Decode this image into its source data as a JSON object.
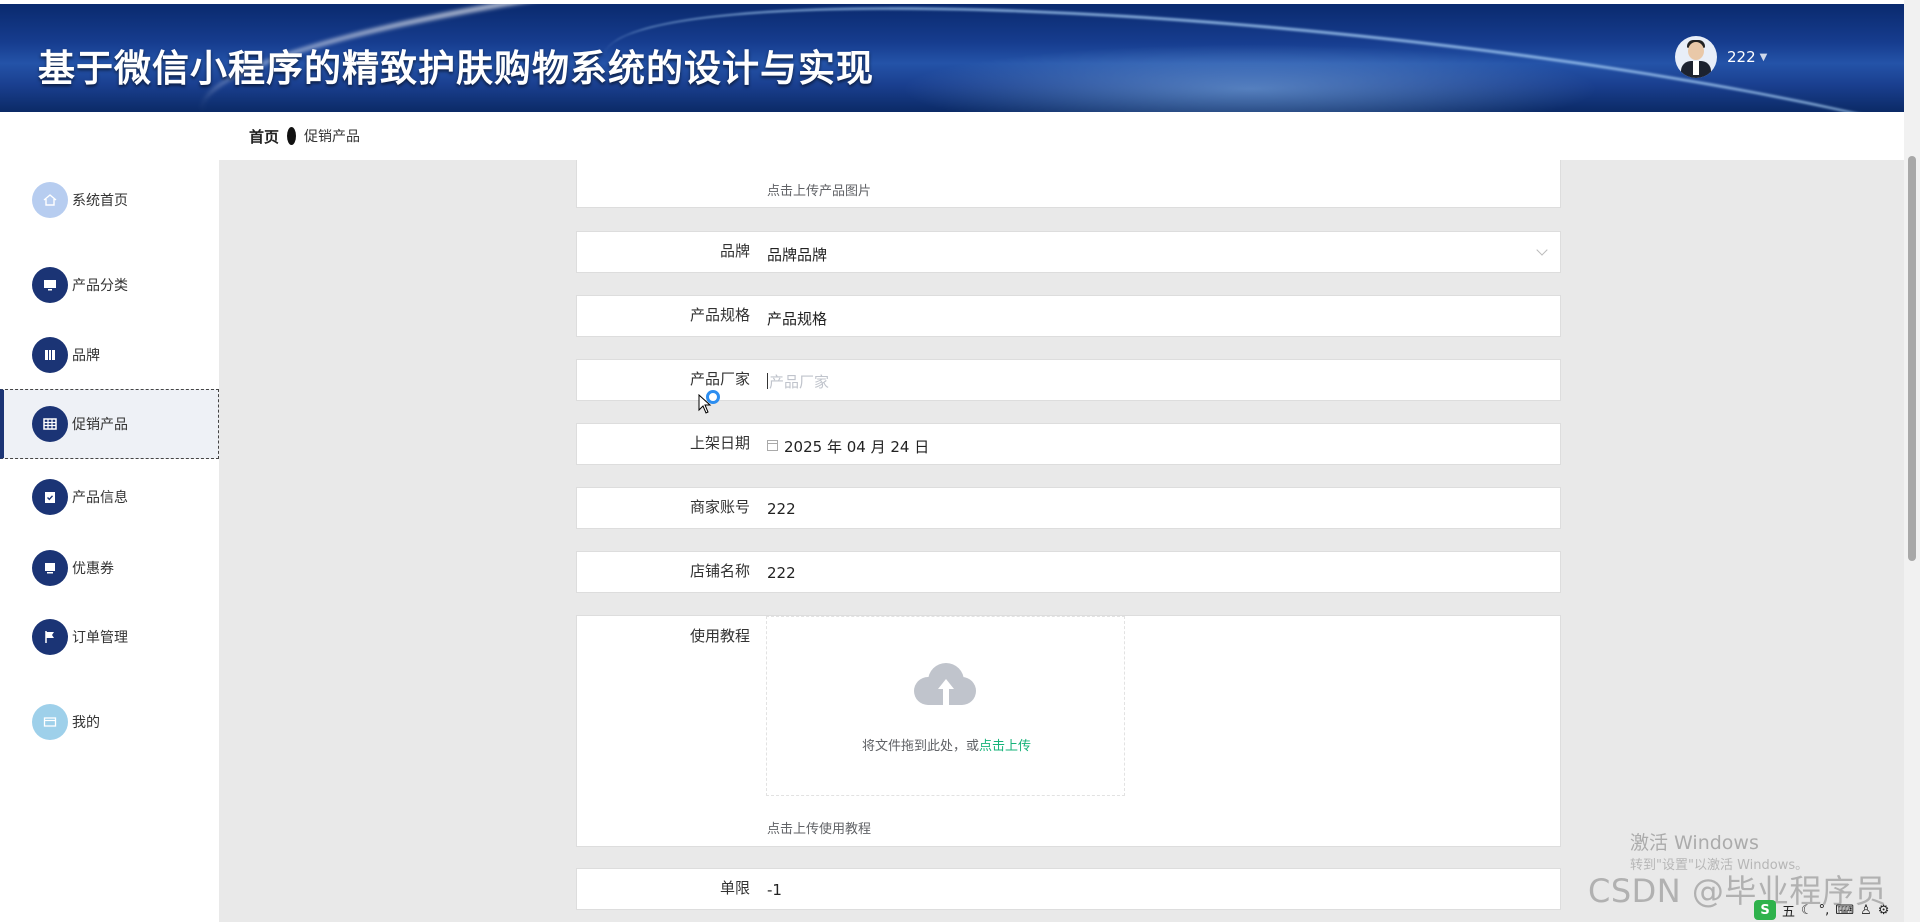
{
  "header": {
    "title": "基于微信小程序的精致护肤购物系统的设计与实现",
    "user_name": "222",
    "caret": "▼"
  },
  "breadcrumb": {
    "home": "首页",
    "current": "促销产品"
  },
  "sidebar": {
    "items": [
      {
        "label": "系统首页",
        "icon": "home-icon"
      },
      {
        "label": "产品分类",
        "icon": "monitor-icon"
      },
      {
        "label": "品牌",
        "icon": "book-icon"
      },
      {
        "label": "促销产品",
        "icon": "grid-icon"
      },
      {
        "label": "产品信息",
        "icon": "clipboard-icon"
      },
      {
        "label": "优惠券",
        "icon": "ticket-icon"
      },
      {
        "label": "订单管理",
        "icon": "flag-icon"
      },
      {
        "label": "我的",
        "icon": "card-icon"
      }
    ],
    "active": "促销产品"
  },
  "form": {
    "image_upload_hint": "点击上传产品图片",
    "brand": {
      "label": "品牌",
      "value": "品牌品牌"
    },
    "spec": {
      "label": "产品规格",
      "value": "产品规格"
    },
    "maker": {
      "label": "产品厂家",
      "placeholder": "产品厂家"
    },
    "date": {
      "label": "上架日期",
      "value": "2025 年 04 月 24 日"
    },
    "merchant": {
      "label": "商家账号",
      "value": "222"
    },
    "shop": {
      "label": "店铺名称",
      "value": "222"
    },
    "tutorial": {
      "label": "使用教程",
      "drop_text": "将文件拖到此处，或",
      "drop_link": "点击上传",
      "hint": "点击上传使用教程"
    },
    "limit": {
      "label": "单限",
      "value": "-1"
    }
  },
  "watermark": {
    "line1": "激活 Windows",
    "line2": "转到\"设置\"以激活 Windows。",
    "line3": "CSDN @毕业程序员"
  },
  "tray": {
    "ime_logo": "S",
    "ime_mode": "五"
  },
  "colors": {
    "header_blue": "#163c8e",
    "nav_icon_dark": "#1b3475",
    "upload_link": "#17b37a"
  }
}
